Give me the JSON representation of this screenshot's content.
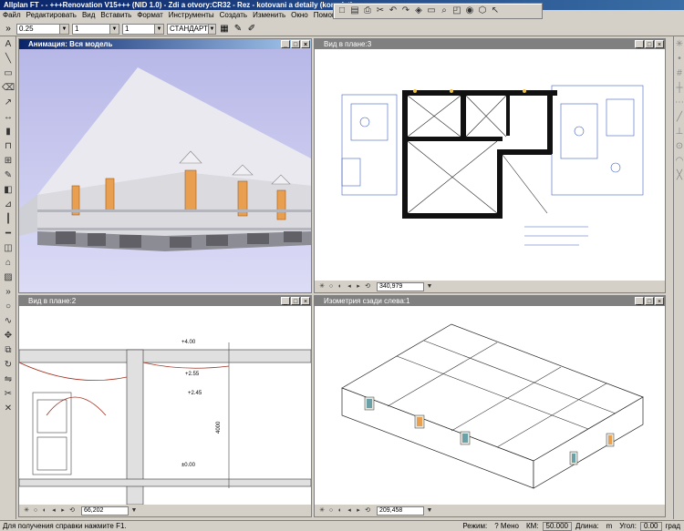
{
  "app": {
    "title": "Allplan FT - - +++Renovation V15+++ (NID 1.0) - Zdi a otvory:CR32 - Rez - kotovani a detaily (komplet)"
  },
  "menu": [
    "Файл",
    "Редактировать",
    "Вид",
    "Вставить",
    "Формат",
    "Инструменты",
    "Создать",
    "Изменить",
    "Окно",
    "Помощь"
  ],
  "properties": {
    "pen": "0.25",
    "line": "1",
    "color": "1",
    "layer": "СТАНДАРТ"
  },
  "viewports": {
    "top_left": {
      "title": "Анимация: Вся модель"
    },
    "top_right": {
      "title": "Вид в плане:3",
      "scale": "340,979"
    },
    "bottom_left": {
      "title": "Вид в плане:2",
      "scale": "66,202"
    },
    "bottom_right": {
      "title": "Изометрия сзади слева:1",
      "scale": "209,458"
    }
  },
  "section": {
    "levels": [
      "+4.00",
      "+2.55",
      "+2.45",
      "±0.00"
    ],
    "height_dim": "4000"
  },
  "status": {
    "hint": "Для получения справки нажмите F1.",
    "mode_label": "Режим:",
    "mode_value": "? Мено",
    "km_label": "КМ:",
    "km_value": "50.000",
    "length_label": "Длина:",
    "length_value": "m",
    "angle_label": "Угол:",
    "angle_value": "0.00",
    "unit": "град"
  },
  "colors": {
    "accent": "#0a246a",
    "viewport_bg": "#ffffff",
    "anim_sky": "#c8c8ee",
    "window_orange": "#e8a050"
  }
}
